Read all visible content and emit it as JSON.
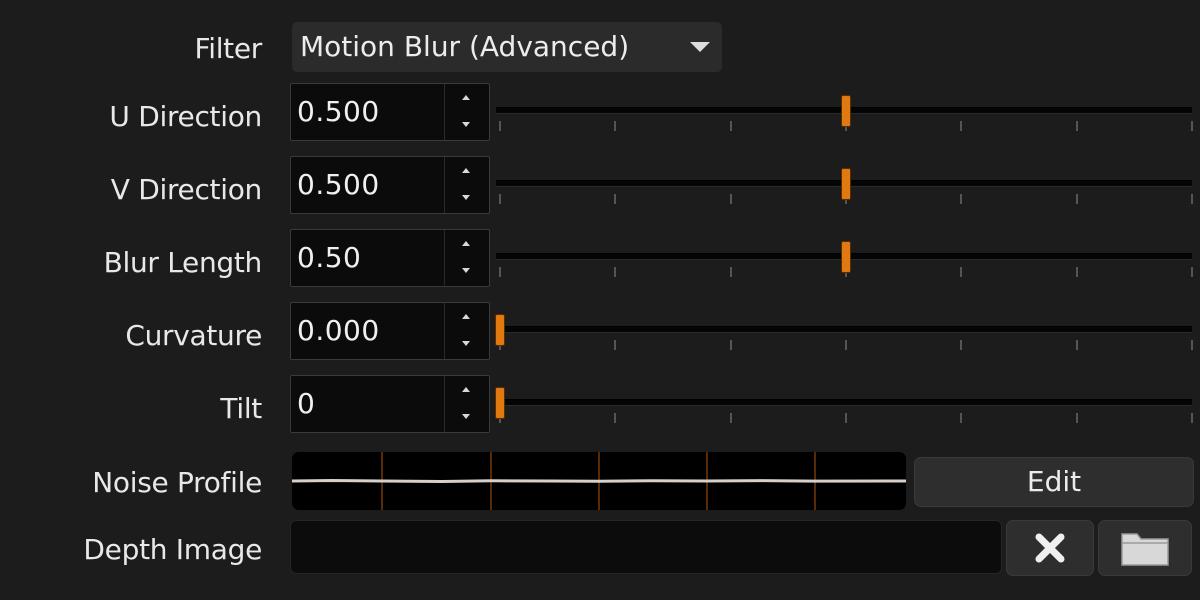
{
  "filter": {
    "label": "Filter",
    "selected": "Motion Blur (Advanced)"
  },
  "params": [
    {
      "label": "U Direction",
      "value": "0.500",
      "level": 0.5
    },
    {
      "label": "V Direction",
      "value": "0.500",
      "level": 0.5
    },
    {
      "label": "Blur Length",
      "value": "0.50",
      "level": 0.5
    },
    {
      "label": "Curvature",
      "value": "0.000",
      "level": 0.0
    },
    {
      "label": "Tilt",
      "value": "0",
      "level": 0.0
    }
  ],
  "noise_profile": {
    "label": "Noise Profile",
    "edit_label": "Edit"
  },
  "depth_image": {
    "label": "Depth Image",
    "value": ""
  },
  "icons": {
    "dropdown": "chevron-down-icon",
    "spin_up": "spin-up-icon",
    "spin_down": "spin-down-icon",
    "clear": "close-icon",
    "browse": "folder-icon"
  },
  "colors": {
    "handle": "#e07a10",
    "background": "#1c1c1c"
  }
}
